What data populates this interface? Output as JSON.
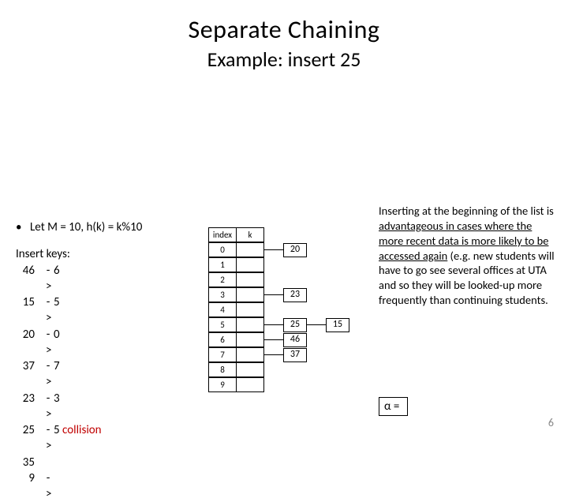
{
  "title": "Separate Chaining",
  "subtitle": "Example: insert 25",
  "bullet": "Let M = 10,   h(k) = k%10",
  "insert_label": "Insert keys:",
  "keys": [
    {
      "k": "46",
      "arrow": "->",
      "h": "6"
    },
    {
      "k": "15",
      "arrow": "->",
      "h": "5"
    },
    {
      "k": "20",
      "arrow": "->",
      "h": "0"
    },
    {
      "k": "37",
      "arrow": "->",
      "h": "7"
    },
    {
      "k": "23",
      "arrow": "->",
      "h": "3"
    },
    {
      "k": "25",
      "arrow": "->",
      "h": "5",
      "note": "collision"
    },
    {
      "k": "35",
      "arrow": "",
      "h": ""
    },
    {
      "k": "9",
      "arrow": "->",
      "h": ""
    }
  ],
  "table": {
    "headers": {
      "index": "index",
      "k": "k"
    },
    "rows": [
      {
        "index": "0",
        "chain": [
          "20"
        ]
      },
      {
        "index": "1",
        "chain": []
      },
      {
        "index": "2",
        "chain": []
      },
      {
        "index": "3",
        "chain": [
          "23"
        ]
      },
      {
        "index": "4",
        "chain": []
      },
      {
        "index": "5",
        "chain": [
          "25",
          "15"
        ]
      },
      {
        "index": "6",
        "chain": [
          "46"
        ]
      },
      {
        "index": "7",
        "chain": [
          "37"
        ]
      },
      {
        "index": "8",
        "chain": []
      },
      {
        "index": "9",
        "chain": []
      }
    ]
  },
  "explain": {
    "t1": "Inserting at the beginning of the list is ",
    "u1": "advantageous in cases where the more recent data is more likely to be accessed again",
    "t2": " (e.g. new students will have to go see several offices at UTA and so they will be looked-up more frequently than continuing students."
  },
  "alpha": "α =",
  "pagenum": "6"
}
